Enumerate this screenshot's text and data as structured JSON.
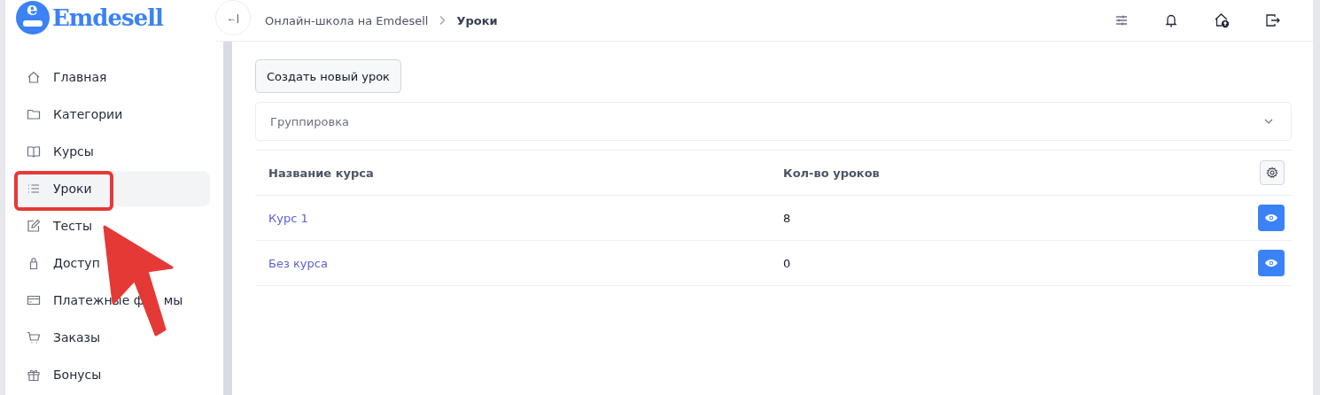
{
  "logo": {
    "text": "Emdesell",
    "letter": "e"
  },
  "header": {
    "collapse": "←|",
    "breadcrumbs": [
      {
        "label": "Онлайн-школа на Emdesell",
        "current": false
      },
      {
        "label": "Уроки",
        "current": true
      }
    ]
  },
  "sidebar": {
    "items": [
      {
        "label": [
          "Главная"
        ],
        "selected": false
      },
      {
        "label": [
          "Категории"
        ],
        "selected": false
      },
      {
        "label": [
          "Курсы"
        ],
        "selected": false
      },
      {
        "label": [
          "Уроки"
        ],
        "selected": true
      },
      {
        "label": [
          "Тесты"
        ],
        "selected": false
      },
      {
        "label": [
          "Доступ"
        ],
        "selected": false
      },
      {
        "label": [
          "Платежные ф",
          "мы"
        ],
        "selected": false
      },
      {
        "label": [
          "Заказы"
        ],
        "selected": false
      },
      {
        "label": [
          "Бонусы"
        ],
        "selected": false
      }
    ]
  },
  "create_button": "Создать новый урок",
  "grouping": {
    "placeholder": "Группировка"
  },
  "table": {
    "columns": [
      "Название курса",
      "Кол-во уроков"
    ],
    "rows": [
      {
        "name": "Курс 1",
        "count": "8"
      },
      {
        "name": "Без курса",
        "count": "0"
      }
    ]
  }
}
